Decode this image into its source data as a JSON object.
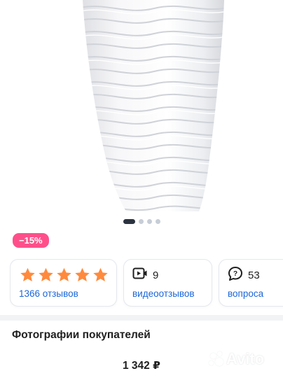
{
  "gallery": {
    "image_icon": "white-wavy-vase",
    "pagination": {
      "total": 4,
      "active": 0
    }
  },
  "discount_badge": "−15%",
  "summary_cards": {
    "rating": {
      "stars": 5,
      "star_color": "#ff8a3d",
      "link": "1366 отзывов"
    },
    "video": {
      "icon": "video-icon",
      "count": "9",
      "link": "видеоотзывов"
    },
    "questions": {
      "icon": "question-bubble-icon",
      "count": "53",
      "link": "вопроса"
    }
  },
  "section": {
    "title": "Фотографии покупателей"
  },
  "price": "1 342 ₽",
  "watermark": {
    "logo": "avito-logo",
    "text": "Avito"
  },
  "colors": {
    "accent": "#1a66d9",
    "discount": "#ff4f8b",
    "star": "#ff8a3d"
  }
}
